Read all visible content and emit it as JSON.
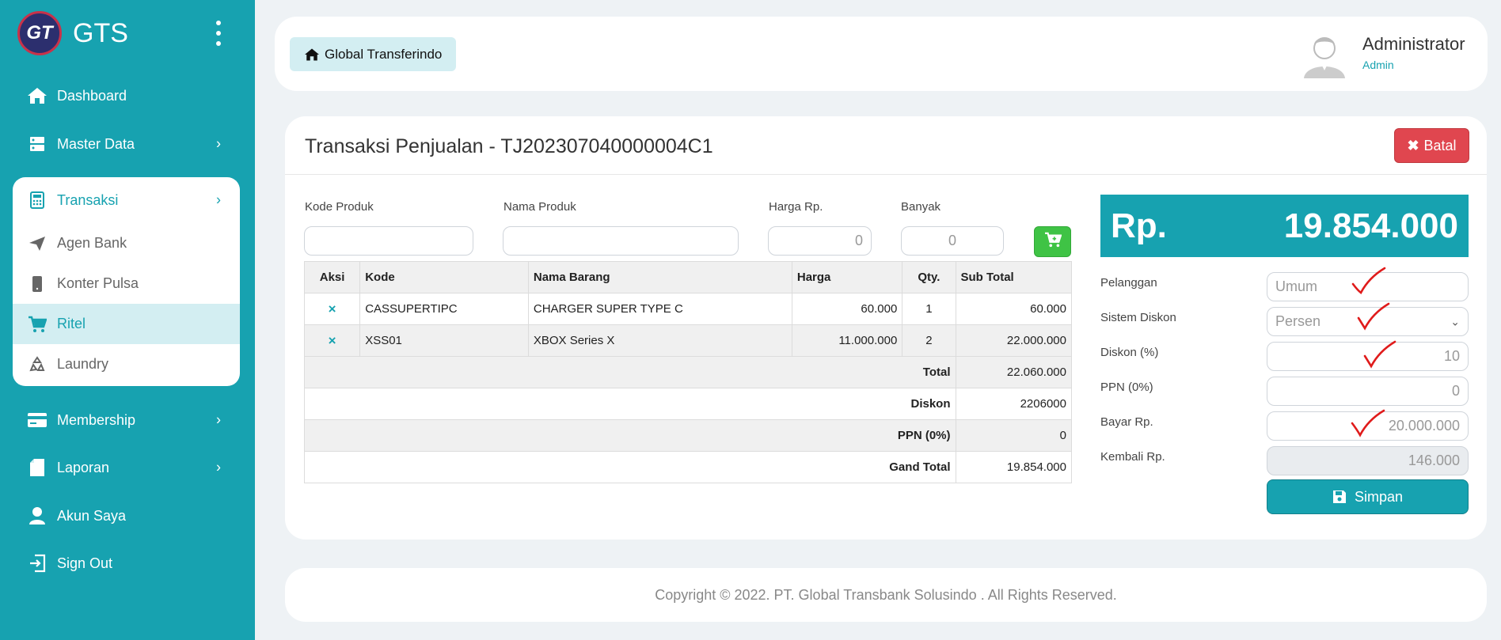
{
  "brand": {
    "logo_text": "GT",
    "name": "GTS"
  },
  "sidebar": {
    "items": [
      {
        "label": "Dashboard",
        "icon": "home-icon"
      },
      {
        "label": "Master Data",
        "icon": "server-icon"
      },
      {
        "label": "Transaksi",
        "icon": "calculator-icon"
      },
      {
        "label": "Membership",
        "icon": "credit-card-icon"
      },
      {
        "label": "Laporan",
        "icon": "file-icon"
      },
      {
        "label": "Akun Saya",
        "icon": "user-icon"
      },
      {
        "label": "Sign Out",
        "icon": "sign-out-icon"
      }
    ],
    "transaksi_sub": [
      {
        "label": "Agen Bank",
        "icon": "paper-plane-icon"
      },
      {
        "label": "Konter Pulsa",
        "icon": "mobile-icon"
      },
      {
        "label": "Ritel",
        "icon": "cart-icon"
      },
      {
        "label": "Laundry",
        "icon": "recycle-icon"
      }
    ]
  },
  "header": {
    "breadcrumb": "Global Transferindo",
    "user_name": "Administrator",
    "user_role": "Admin"
  },
  "main": {
    "title": "Transaksi Penjualan - TJ202307040000004C1",
    "cancel_label": "Batal",
    "form": {
      "kode_label": "Kode Produk",
      "nama_label": "Nama Produk",
      "harga_label": "Harga Rp.",
      "harga_value": "0",
      "banyak_label": "Banyak",
      "banyak_value": "0"
    },
    "table": {
      "headers": [
        "Aksi",
        "Kode",
        "Nama Barang",
        "Harga",
        "Qty.",
        "Sub Total"
      ],
      "rows": [
        {
          "aksi": "×",
          "kode": "CASSUPERTIPC",
          "nama": "CHARGER SUPER TYPE C",
          "harga": "60.000",
          "qty": "1",
          "subtotal": "60.000"
        },
        {
          "aksi": "×",
          "kode": "XSS01",
          "nama": "XBOX Series X",
          "harga": "11.000.000",
          "qty": "2",
          "subtotal": "22.000.000"
        }
      ],
      "summary": [
        {
          "label": "Total",
          "value": "22.060.000"
        },
        {
          "label": "Diskon",
          "value": "2206000"
        },
        {
          "label": "PPN (0%)",
          "value": "0"
        },
        {
          "label": "Gand Total",
          "value": "19.854.000"
        }
      ]
    }
  },
  "payment": {
    "currency": "Rp.",
    "amount": "19.854.000",
    "pelanggan_label": "Pelanggan",
    "pelanggan_value": "Umum",
    "sistem_diskon_label": "Sistem Diskon",
    "sistem_diskon_value": "Persen",
    "diskon_label": "Diskon (%)",
    "diskon_value": "10",
    "ppn_label": "PPN (0%)",
    "ppn_value": "0",
    "bayar_label": "Bayar Rp.",
    "bayar_value": "20.000.000",
    "kembali_label": "Kembali Rp.",
    "kembali_value": "146.000",
    "save_label": "Simpan",
    "check_color": "#e01b1b"
  },
  "footer": {
    "copyright": "Copyright © 2022. PT. Global Transbank Solusindo . All Rights Reserved."
  },
  "colors": {
    "primary": "#17a2b0",
    "danger": "#e0464f",
    "success": "#3fc345"
  }
}
